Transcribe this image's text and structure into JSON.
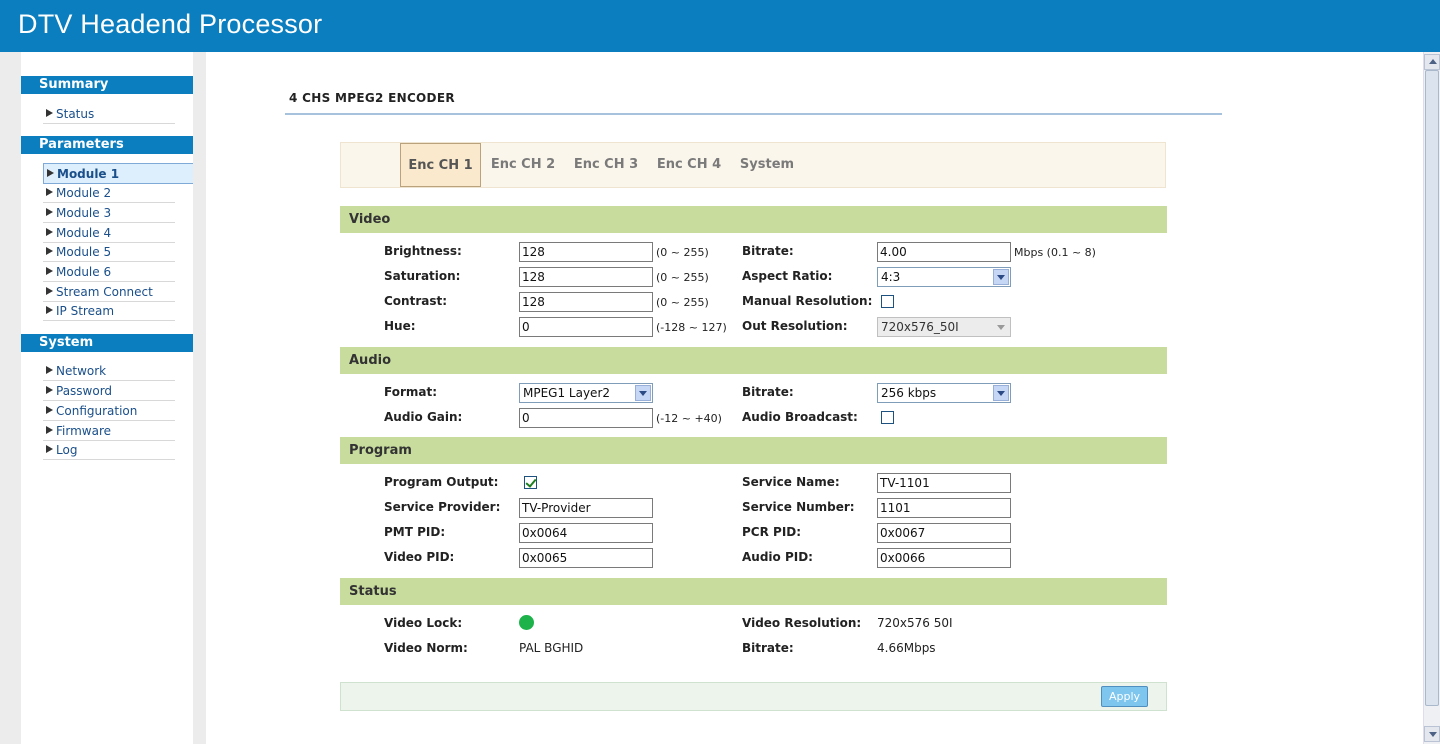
{
  "header": {
    "title": "DTV Headend Processor"
  },
  "sidebar": {
    "sections": [
      {
        "title": "Summary",
        "items": [
          "Status"
        ]
      },
      {
        "title": "Parameters",
        "items": [
          "Module 1",
          "Module 2",
          "Module 3",
          "Module 4",
          "Module 5",
          "Module 6",
          "Stream Connect",
          "IP Stream"
        ]
      },
      {
        "title": "System",
        "items": [
          "Network",
          "Password",
          "Configuration",
          "Firmware",
          "Log"
        ]
      }
    ],
    "active_item": "Module 1"
  },
  "main": {
    "page_title": "4 CHS MPEG2 ENCODER",
    "tabs": [
      "Enc CH 1",
      "Enc CH 2",
      "Enc CH 3",
      "Enc CH 4",
      "System"
    ],
    "active_tab": "Enc CH 1",
    "video": {
      "title": "Video",
      "brightness": {
        "label": "Brightness:",
        "value": "128",
        "range": "(0 ~ 255)"
      },
      "saturation": {
        "label": "Saturation:",
        "value": "128",
        "range": "(0 ~ 255)"
      },
      "contrast": {
        "label": "Contrast:",
        "value": "128",
        "range": "(0 ~ 255)"
      },
      "hue": {
        "label": "Hue:",
        "value": "0",
        "range": "(-128 ~ 127)"
      },
      "bitrate": {
        "label": "Bitrate:",
        "value": "4.00",
        "range": "Mbps (0.1 ~ 8)"
      },
      "aspect_ratio": {
        "label": "Aspect Ratio:",
        "value": "4:3"
      },
      "manual_resolution": {
        "label": "Manual Resolution:",
        "checked": false
      },
      "out_resolution": {
        "label": "Out Resolution:",
        "value": "720x576_50I",
        "disabled": true
      }
    },
    "audio": {
      "title": "Audio",
      "format": {
        "label": "Format:",
        "value": "MPEG1 Layer2"
      },
      "audio_gain": {
        "label": "Audio Gain:",
        "value": "0",
        "range": "(-12 ~ +40)"
      },
      "bitrate": {
        "label": "Bitrate:",
        "value": "256 kbps"
      },
      "audio_broadcast": {
        "label": "Audio Broadcast:",
        "checked": false
      }
    },
    "program": {
      "title": "Program",
      "program_output": {
        "label": "Program Output:",
        "checked": true
      },
      "service_provider": {
        "label": "Service Provider:",
        "value": "TV-Provider"
      },
      "pmt_pid": {
        "label": "PMT PID:",
        "value": "0x0064"
      },
      "video_pid": {
        "label": "Video PID:",
        "value": "0x0065"
      },
      "service_name": {
        "label": "Service Name:",
        "value": "TV-1101"
      },
      "service_number": {
        "label": "Service Number:",
        "value": "1101"
      },
      "pcr_pid": {
        "label": "PCR PID:",
        "value": "0x0067"
      },
      "audio_pid": {
        "label": "Audio PID:",
        "value": "0x0066"
      }
    },
    "status": {
      "title": "Status",
      "video_lock": {
        "label": "Video Lock:",
        "locked": true,
        "color": "#1db34a"
      },
      "video_norm": {
        "label": "Video Norm:",
        "value": "PAL BGHID"
      },
      "video_resolution": {
        "label": "Video Resolution:",
        "value": "720x576 50I"
      },
      "bitrate": {
        "label": "Bitrate:",
        "value": "4.66Mbps"
      }
    },
    "apply_label": "Apply"
  },
  "colors": {
    "brand": "#0a7ebf",
    "section": "#c8dd9d",
    "tab_active": "#fbe9cd"
  }
}
